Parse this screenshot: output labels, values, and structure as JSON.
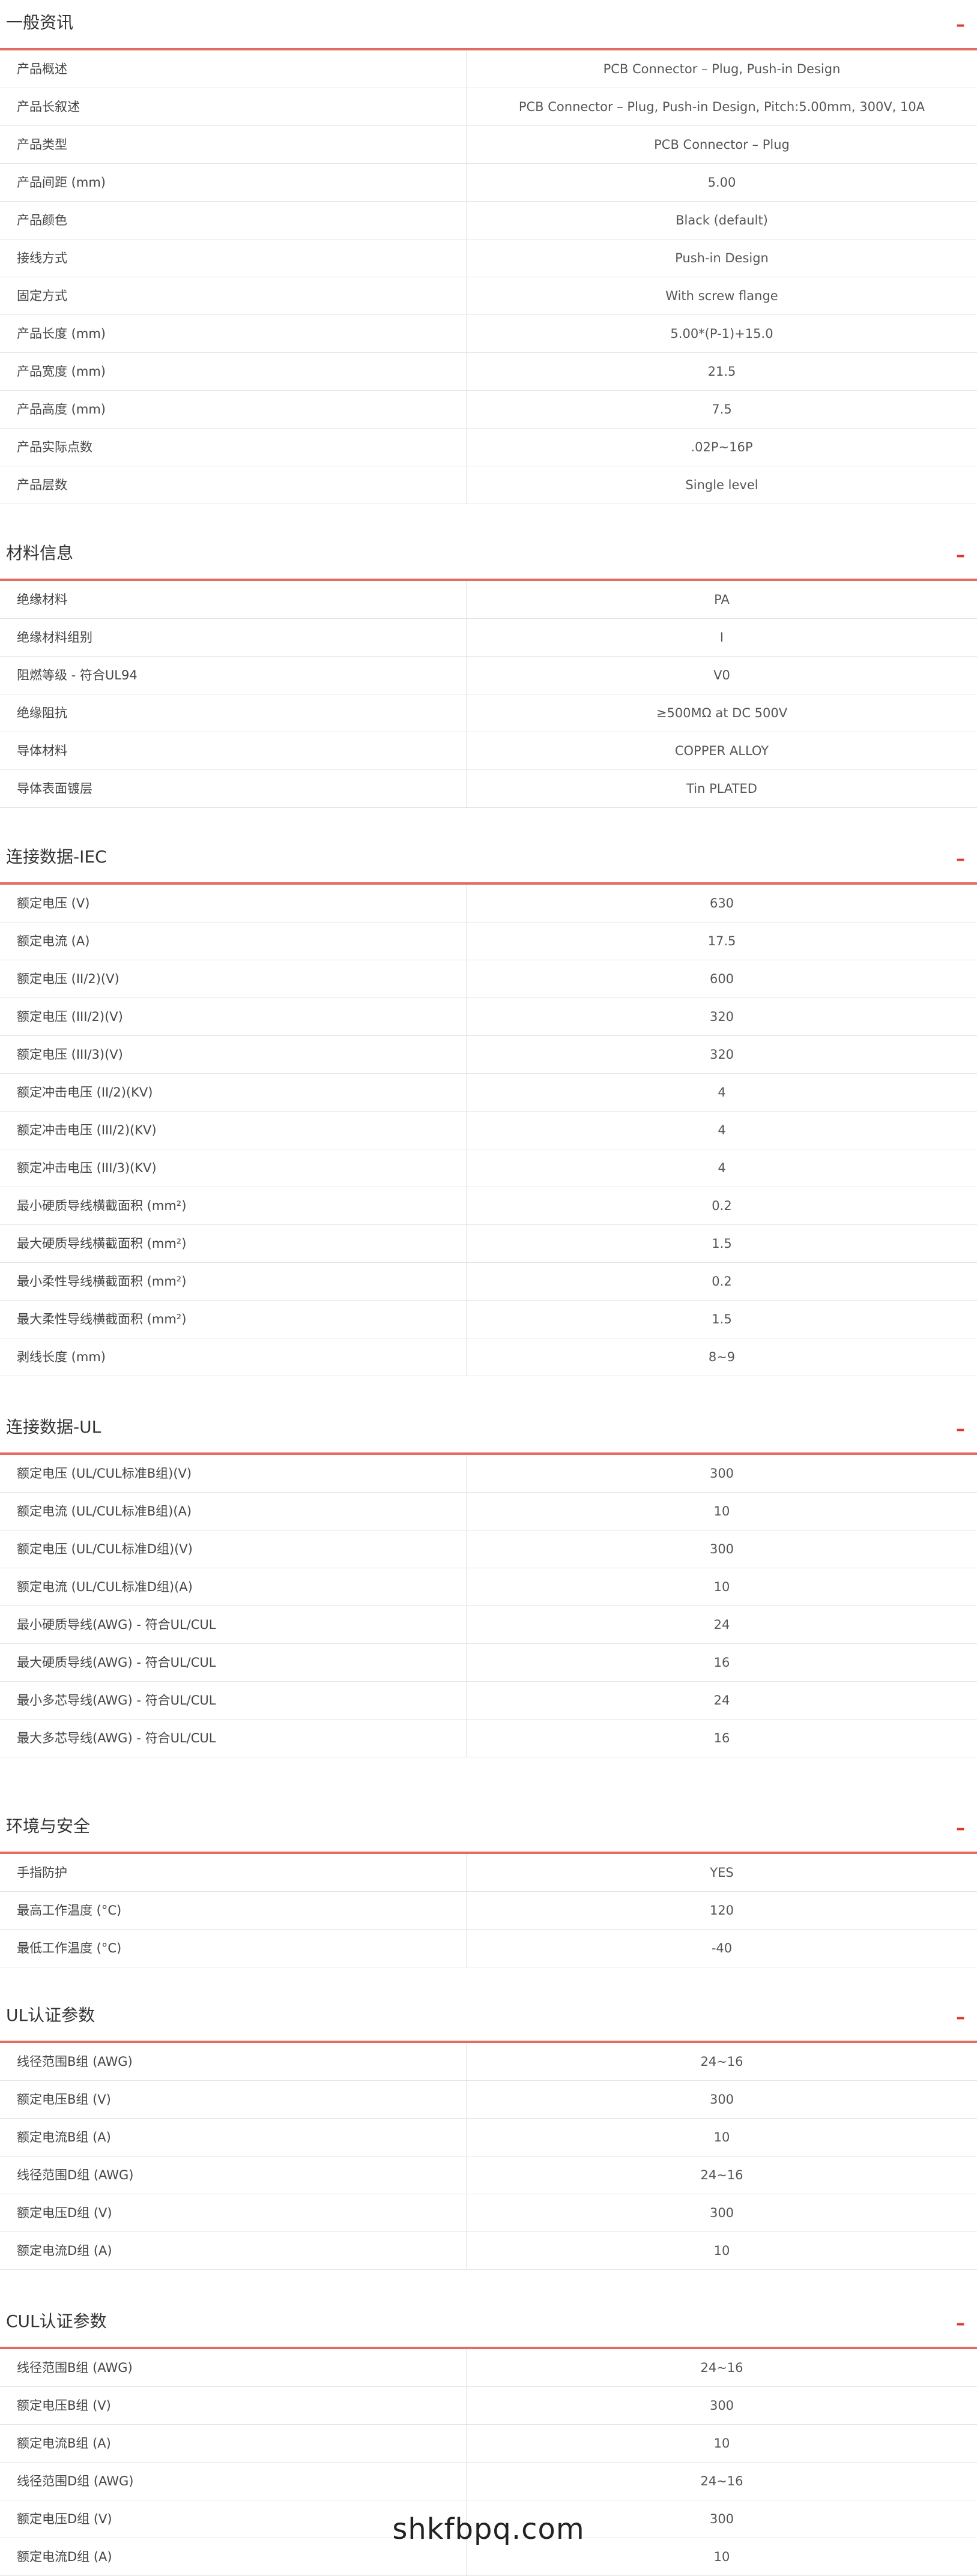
{
  "sections": [
    {
      "title": "一般资讯",
      "rows": [
        {
          "label": "产品概述",
          "value": "PCB Connector – Plug, Push-in Design"
        },
        {
          "label": "产品长叙述",
          "value": "PCB Connector – Plug, Push-in Design, Pitch:5.00mm, 300V, 10A"
        },
        {
          "label": "产品类型",
          "value": "PCB Connector – Plug"
        },
        {
          "label": "产品间距 (mm)",
          "value": "5.00"
        },
        {
          "label": "产品颜色",
          "value": "Black (default)"
        },
        {
          "label": "接线方式",
          "value": "Push-in Design"
        },
        {
          "label": "固定方式",
          "value": "With screw flange"
        },
        {
          "label": "产品长度 (mm)",
          "value": "5.00*(P-1)+15.0"
        },
        {
          "label": "产品宽度 (mm)",
          "value": "21.5"
        },
        {
          "label": "产品高度 (mm)",
          "value": "7.5"
        },
        {
          "label": "产品实际点数",
          "value": ".02P~16P"
        },
        {
          "label": "产品层数",
          "value": "Single level"
        }
      ]
    },
    {
      "title": "材料信息",
      "rows": [
        {
          "label": "绝缘材料",
          "value": "PA"
        },
        {
          "label": "绝缘材料组别",
          "value": "I"
        },
        {
          "label": "阻燃等级 - 符合UL94",
          "value": "V0"
        },
        {
          "label": "绝缘阻抗",
          "value": "≥500MΩ at DC 500V"
        },
        {
          "label": "导体材料",
          "value": "COPPER ALLOY"
        },
        {
          "label": "导体表面镀层",
          "value": "Tin PLATED"
        }
      ]
    },
    {
      "title": "连接数据-IEC",
      "rows": [
        {
          "label": "额定电压 (V)",
          "value": "630"
        },
        {
          "label": "额定电流 (A)",
          "value": "17.5"
        },
        {
          "label": "额定电压 (II/2)(V)",
          "value": "600"
        },
        {
          "label": "额定电压 (III/2)(V)",
          "value": "320"
        },
        {
          "label": "额定电压 (III/3)(V)",
          "value": "320"
        },
        {
          "label": "额定冲击电压 (II/2)(KV)",
          "value": "4"
        },
        {
          "label": "额定冲击电压 (III/2)(KV)",
          "value": "4"
        },
        {
          "label": "额定冲击电压 (III/3)(KV)",
          "value": "4"
        },
        {
          "label": "最小硬质导线横截面积 (mm²)",
          "value": "0.2"
        },
        {
          "label": "最大硬质导线横截面积 (mm²)",
          "value": "1.5"
        },
        {
          "label": "最小柔性导线横截面积 (mm²)",
          "value": "0.2"
        },
        {
          "label": "最大柔性导线横截面积 (mm²)",
          "value": "1.5"
        },
        {
          "label": "剥线长度 (mm)",
          "value": "8~9"
        }
      ]
    },
    {
      "title": "连接数据-UL",
      "rows": [
        {
          "label": "额定电压 (UL/CUL标准B组)(V)",
          "value": "300"
        },
        {
          "label": "额定电流 (UL/CUL标准B组)(A)",
          "value": "10"
        },
        {
          "label": "额定电压 (UL/CUL标准D组)(V)",
          "value": "300"
        },
        {
          "label": "额定电流 (UL/CUL标准D组)(A)",
          "value": "10"
        },
        {
          "label": "最小硬质导线(AWG) - 符合UL/CUL",
          "value": "24"
        },
        {
          "label": "最大硬质导线(AWG) - 符合UL/CUL",
          "value": "16"
        },
        {
          "label": "最小多芯导线(AWG) - 符合UL/CUL",
          "value": "24"
        },
        {
          "label": "最大多芯导线(AWG) - 符合UL/CUL",
          "value": "16"
        }
      ]
    },
    {
      "title": "环境与安全",
      "rows": [
        {
          "label": "手指防护",
          "value": "YES"
        },
        {
          "label": "最高工作温度 (°C)",
          "value": "120"
        },
        {
          "label": "最低工作温度 (°C)",
          "value": "-40"
        }
      ]
    },
    {
      "title": "UL认证参数",
      "rows": [
        {
          "label": "线径范围B组 (AWG)",
          "value": "24~16"
        },
        {
          "label": "额定电压B组 (V)",
          "value": "300"
        },
        {
          "label": "额定电流B组 (A)",
          "value": "10"
        },
        {
          "label": "线径范围D组 (AWG)",
          "value": "24~16"
        },
        {
          "label": "额定电压D组 (V)",
          "value": "300"
        },
        {
          "label": "额定电流D组 (A)",
          "value": "10"
        }
      ]
    },
    {
      "title": "CUL认证参数",
      "rows": [
        {
          "label": "线径范围B组 (AWG)",
          "value": "24~16"
        },
        {
          "label": "额定电压B组 (V)",
          "value": "300"
        },
        {
          "label": "额定电流B组 (A)",
          "value": "10"
        },
        {
          "label": "线径范围D组 (AWG)",
          "value": "24~16"
        },
        {
          "label": "额定电压D组 (V)",
          "value": "300"
        },
        {
          "label": "额定电流D组 (A)",
          "value": "10"
        }
      ]
    }
  ],
  "toggle_symbol": "–",
  "footer": {
    "text": "shkfbpq.com"
  },
  "colors": {
    "accent": "#e0382f",
    "header_rule": "#e56b61",
    "row_border": "#e4e4e4"
  }
}
